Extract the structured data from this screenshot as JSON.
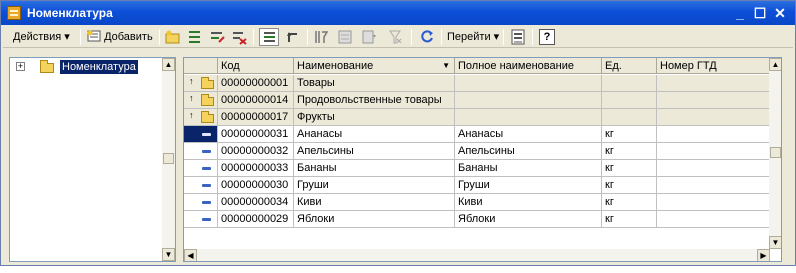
{
  "window": {
    "title": "Номенклатура"
  },
  "toolbar": {
    "actions_label": "Действия",
    "add_label": "Добавить",
    "goto_label": "Перейти",
    "help_label": "?"
  },
  "tree": {
    "root_label": "Номенклатура"
  },
  "grid": {
    "columns": [
      "Код",
      "Наименование",
      "Полное наименование",
      "Ед.",
      "Номер ГТД"
    ],
    "groups": [
      {
        "code": "00000000001",
        "name": "Товары"
      },
      {
        "code": "00000000014",
        "name": "Продовольственные товары"
      },
      {
        "code": "00000000017",
        "name": "Фрукты"
      }
    ],
    "items": [
      {
        "code": "00000000031",
        "name": "Ананасы",
        "full": "Ананасы",
        "unit": "кг"
      },
      {
        "code": "00000000032",
        "name": "Апельсины",
        "full": "Апельсины",
        "unit": "кг"
      },
      {
        "code": "00000000033",
        "name": "Бананы",
        "full": "Бананы",
        "unit": "кг"
      },
      {
        "code": "00000000030",
        "name": "Груши",
        "full": "Груши",
        "unit": "кг"
      },
      {
        "code": "00000000034",
        "name": "Киви",
        "full": "Киви",
        "unit": "кг"
      },
      {
        "code": "00000000029",
        "name": "Яблоки",
        "full": "Яблоки",
        "unit": "кг"
      }
    ]
  }
}
